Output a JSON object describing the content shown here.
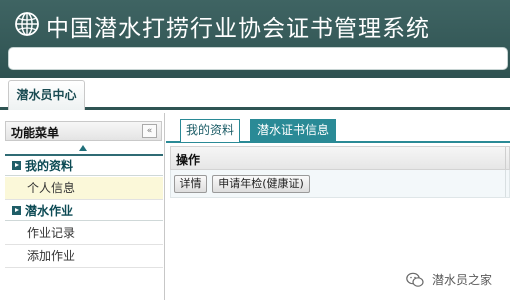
{
  "app": {
    "title": "中国潜水打捞行业协会证书管理系统"
  },
  "top_tab": {
    "label": "潜水员中心"
  },
  "sidebar": {
    "header": "功能菜单",
    "collapse_glyph": "«",
    "groups": [
      {
        "title": "我的资料",
        "items": [
          "个人信息"
        ]
      },
      {
        "title": "潜水作业",
        "items": [
          "作业记录",
          "添加作业"
        ]
      }
    ],
    "active_item": "个人信息"
  },
  "main": {
    "tabs": [
      "我的资料",
      "潜水证书信息"
    ],
    "active_tab": "潜水证书信息",
    "table": {
      "header": "操作",
      "row_actions": [
        "详情",
        "申请年检(健康证)"
      ]
    }
  },
  "watermark": {
    "text": "潜水员之家"
  },
  "colors": {
    "header_bg": "#3a5e5d",
    "accent": "#2a8a96",
    "active_row": "#fbf8d9"
  }
}
